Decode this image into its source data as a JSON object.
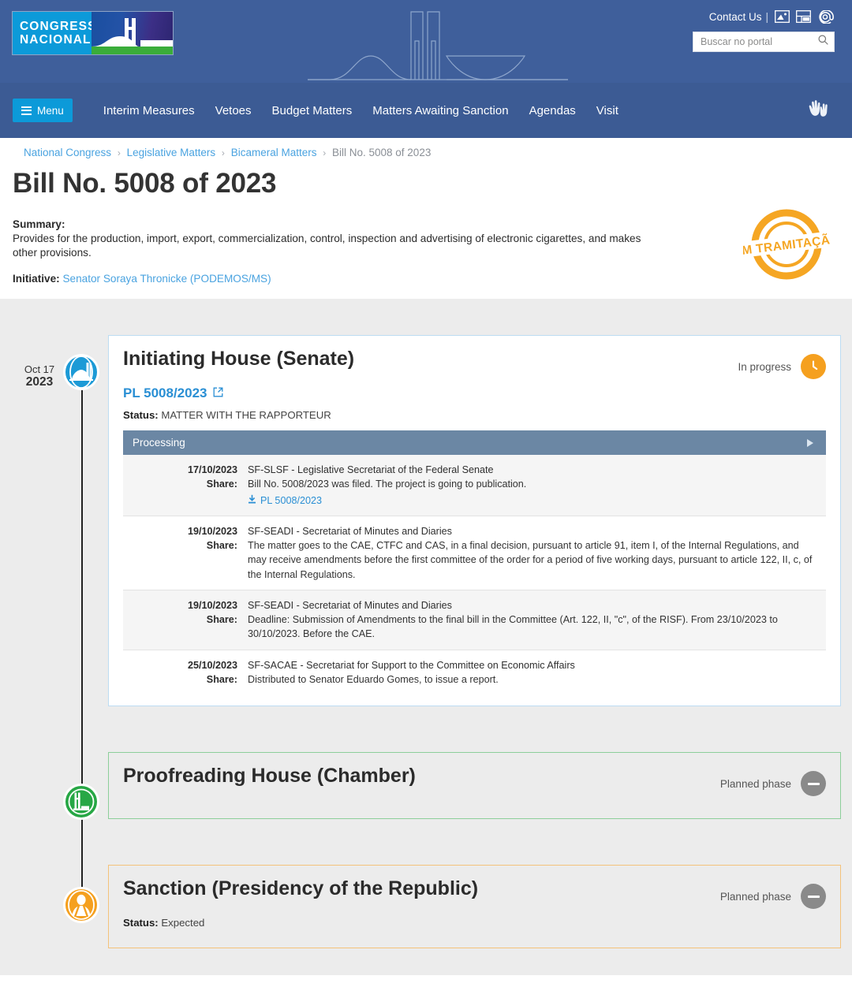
{
  "header": {
    "logo_line1": "CONGRESSO",
    "logo_line2": "NACIONAL",
    "contact_label": "Contact Us",
    "separator": "|",
    "icons": [
      "monitor-icon",
      "window-icon",
      "at-sign-icon"
    ],
    "search_placeholder": "Buscar no portal",
    "search_value": ""
  },
  "nav": {
    "menu_label": "Menu",
    "links": [
      "Interim Measures",
      "Vetoes",
      "Budget Matters",
      "Matters Awaiting Sanction",
      "Agendas",
      "Visit"
    ],
    "accessibility_icon": "sign-language-hands-icon"
  },
  "breadcrumb": {
    "items": [
      "National Congress",
      "Legislative Matters",
      "Bicameral Matters"
    ],
    "current": "Bill No. 5008 of 2023",
    "separator": "›"
  },
  "page": {
    "title": "Bill No. 5008 of 2023",
    "summary_label": "Summary:",
    "summary_text": "Provides for the production, import, export, commercialization, control, inspection and advertising of electronic cigarettes, and makes other provisions.",
    "initiative_label": "Initiative:",
    "initiative_value": "Senator Soraya Thronicke (PODEMOS/MS)",
    "stamp_text": "EM TRAMITAÇÃO",
    "stamp_color": "#f5a623"
  },
  "timeline": [
    {
      "date_day": "Oct 17",
      "date_year": "2023",
      "node_icon": "senate-dome-icon",
      "node_color": "#1c9ad6",
      "title": "Initiating House (Senate)",
      "state_label": "In progress",
      "state_icon": "clock-icon",
      "state_color": "#f5a01f",
      "link_label": "PL 5008/2023",
      "link_icon": "external-link-icon",
      "status_label": "Status:",
      "status_value": "MATTER WITH THE RAPPORTEUR",
      "table": {
        "header": "Processing",
        "toggle_icon": "play-arrow-icon",
        "rows": [
          {
            "date": "17/10/2023",
            "share_label": "Share:",
            "org": "SF-SLSF - Legislative Secretariat of the Federal Senate",
            "desc": "Bill No. 5008/2023 was filed. The project is going to publication.",
            "file_label": "PL 5008/2023",
            "file_icon": "download-icon"
          },
          {
            "date": "19/10/2023",
            "share_label": "Share:",
            "org": "SF-SEADI - Secretariat of Minutes and Diaries",
            "desc": "The matter goes to the CAE, CTFC and CAS, in a final decision, pursuant to article 91, item I, of the Internal Regulations, and may receive amendments before the first committee of the order for a period of five working days, pursuant to article 122, II, c, of the Internal Regulations.",
            "file_label": "",
            "file_icon": ""
          },
          {
            "date": "19/10/2023",
            "share_label": "Share:",
            "org": "SF-SEADI - Secretariat of Minutes and Diaries",
            "desc": "Deadline: Submission of Amendments to the final bill in the Committee (Art. 122, II, \"c\", of the RISF). From 23/10/2023 to 30/10/2023. Before the CAE.",
            "file_label": "",
            "file_icon": ""
          },
          {
            "date": "25/10/2023",
            "share_label": "Share:",
            "org": "SF-SACAE - Secretariat for Support to the Committee on Economic Affairs",
            "desc": "Distributed to Senator Eduardo Gomes, to issue a report.",
            "file_label": "",
            "file_icon": ""
          }
        ]
      }
    },
    {
      "date_day": "",
      "date_year": "",
      "node_icon": "chamber-deputies-icon",
      "node_color": "#27a745",
      "title": "Proofreading House (Chamber)",
      "state_label": "Planned phase",
      "state_icon": "minus-icon",
      "state_color": "#8a8a8a",
      "link_label": "",
      "status_label": "",
      "status_value": ""
    },
    {
      "date_day": "",
      "date_year": "",
      "node_icon": "presidency-person-icon",
      "node_color": "#f5a01f",
      "title": "Sanction (Presidency of the Republic)",
      "state_label": "Planned phase",
      "state_icon": "minus-icon",
      "state_color": "#8a8a8a",
      "link_label": "",
      "status_label": "Status:",
      "status_value": "Expected"
    }
  ]
}
